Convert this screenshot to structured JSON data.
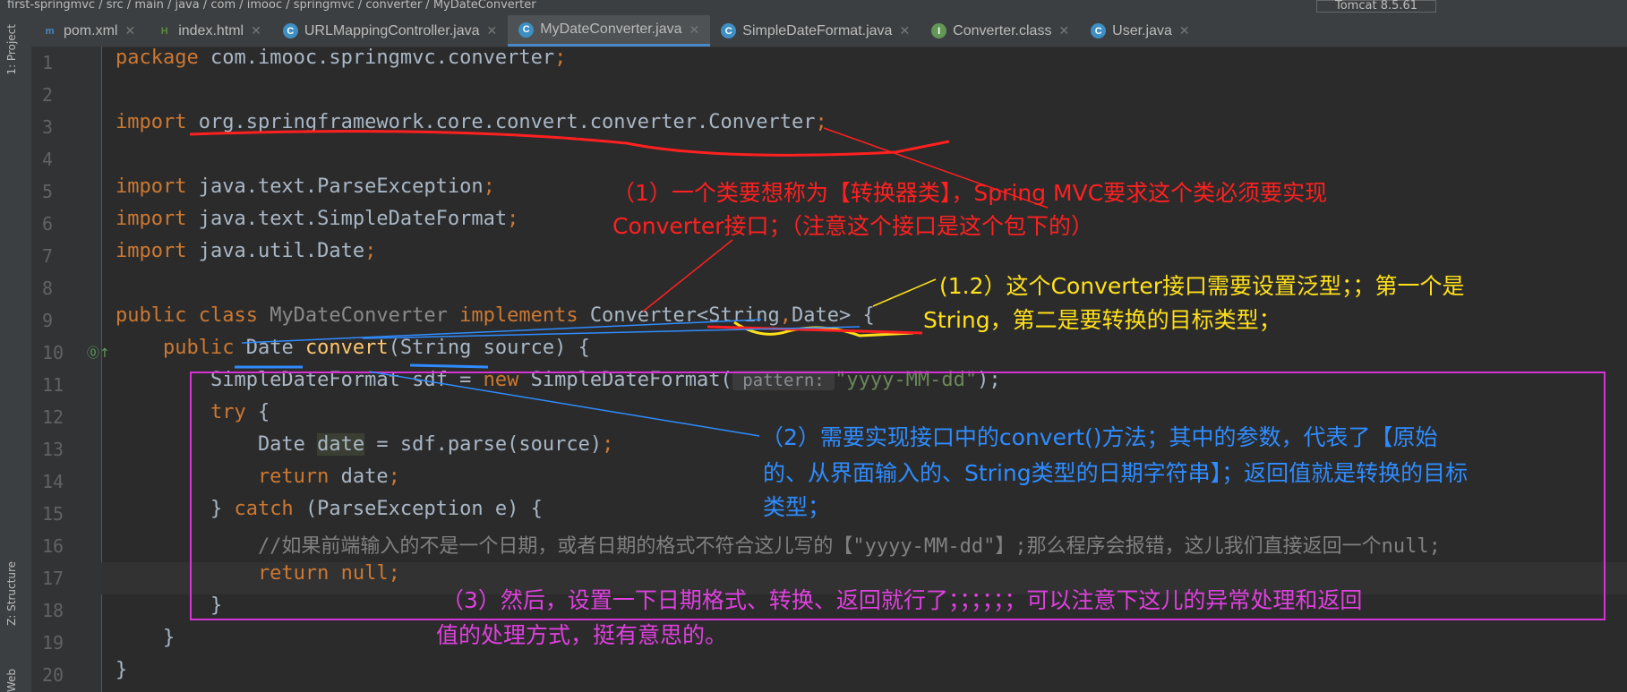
{
  "breadcrumb": "first-springmvc / src / main / java / com / imooc / springmvc / converter / MyDateConverter",
  "run_config": "Tomcat 8.5.61",
  "side_labels": {
    "project": "1: Project",
    "structure": "Z: Structure",
    "web": "Web"
  },
  "tabs": [
    {
      "label": "pom.xml",
      "icon": "m",
      "color": "#4a88c7",
      "active": false
    },
    {
      "label": "index.html",
      "icon": "H",
      "color": "#5b8a3a",
      "active": false
    },
    {
      "label": "URLMappingController.java",
      "icon": "C",
      "color": "#3d8fc4",
      "active": false
    },
    {
      "label": "MyDateConverter.java",
      "icon": "C",
      "color": "#3d8fc4",
      "active": true
    },
    {
      "label": "SimpleDateFormat.java",
      "icon": "C",
      "color": "#3d8fc4",
      "active": false
    },
    {
      "label": "Converter.class",
      "icon": "I",
      "color": "#629755",
      "active": false
    },
    {
      "label": "User.java",
      "icon": "C",
      "color": "#3d8fc4",
      "active": false
    }
  ],
  "current_line": 17,
  "code": [
    [
      [
        "package ",
        "kw"
      ],
      [
        "com.imooc.springmvc.converter",
        ""
      ],
      [
        ";",
        "kw"
      ]
    ],
    [],
    [
      [
        "import ",
        "kw"
      ],
      [
        "org.springframework.core.convert.converter.Converter",
        ""
      ],
      [
        ";",
        "kw"
      ]
    ],
    [],
    [
      [
        "import ",
        "kw"
      ],
      [
        "java.text.ParseException",
        ""
      ],
      [
        ";",
        "kw"
      ]
    ],
    [
      [
        "import ",
        "kw"
      ],
      [
        "java.text.SimpleDateFormat",
        ""
      ],
      [
        ";",
        "kw"
      ]
    ],
    [
      [
        "import ",
        "kw"
      ],
      [
        "java.util.Date",
        ""
      ],
      [
        ";",
        "kw"
      ]
    ],
    [],
    [
      [
        "public class ",
        "kw"
      ],
      [
        "MyDateConverter ",
        "gr"
      ],
      [
        "implements ",
        "kw"
      ],
      [
        "Converter<String",
        ""
      ],
      [
        ",",
        "kw"
      ],
      [
        "Date> {",
        ""
      ]
    ],
    [
      [
        "    public ",
        "kw"
      ],
      [
        "Date ",
        ""
      ],
      [
        "convert",
        "fn"
      ],
      [
        "(String source) {",
        ""
      ]
    ],
    [
      [
        "        SimpleDateFormat sdf = ",
        ""
      ],
      [
        "new ",
        "kw"
      ],
      [
        "SimpleDateFormat(",
        ""
      ],
      [
        " pattern: ",
        "hint"
      ],
      [
        "\"yyyy-MM-dd\"",
        "str"
      ],
      [
        ");",
        ""
      ]
    ],
    [
      [
        "        try ",
        "kw"
      ],
      [
        "{",
        ""
      ]
    ],
    [
      [
        "            Date ",
        ""
      ],
      [
        "date",
        "hl"
      ],
      [
        " = sdf.parse(source)",
        ""
      ],
      [
        ";",
        "kw"
      ]
    ],
    [
      [
        "            return ",
        "kw"
      ],
      [
        "date",
        ""
      ],
      [
        ";",
        "kw"
      ]
    ],
    [
      [
        "        } ",
        ""
      ],
      [
        "catch ",
        "kw"
      ],
      [
        "(ParseException e) {",
        ""
      ]
    ],
    [
      [
        "            //如果前端输入的不是一个日期，或者日期的格式不符合这儿写的【\"yyyy-MM-dd\"】;那么程序会报错，这儿我们直接返回一个null;",
        "cm"
      ]
    ],
    [
      [
        "            return null",
        "kw"
      ],
      [
        ";",
        "kw"
      ]
    ],
    [
      [
        "        }",
        ""
      ]
    ],
    [
      [
        "    }",
        ""
      ]
    ],
    [
      [
        "}",
        ""
      ]
    ]
  ],
  "annotations": {
    "red": [
      "（1）一个类要想称为【转换器类】，Spring MVC要求这个类必须要实现",
      "Converter接口；（注意这个接口是这个包下的）"
    ],
    "yellow": [
      "(1.2）这个Converter接口需要设置泛型；；第一个是",
      "String，第二是要转换的目标类型；"
    ],
    "blue": [
      "（2）需要实现接口中的convert()方法；其中的参数，代表了【原始",
      "的、从界面输入的、String类型的日期字符串】；返回值就是转换的目标",
      "类型；"
    ],
    "magenta": [
      "（3）然后，设置一下日期格式、转换、返回就行了；；；；；；可以注意下这儿的异常处理和返回",
      "值的处理方式，挺有意思的。"
    ],
    "colors": {
      "red": "#ff2020",
      "yellow": "#ffe01a",
      "blue": "#2f8cff",
      "magenta": "#e040e0"
    }
  }
}
